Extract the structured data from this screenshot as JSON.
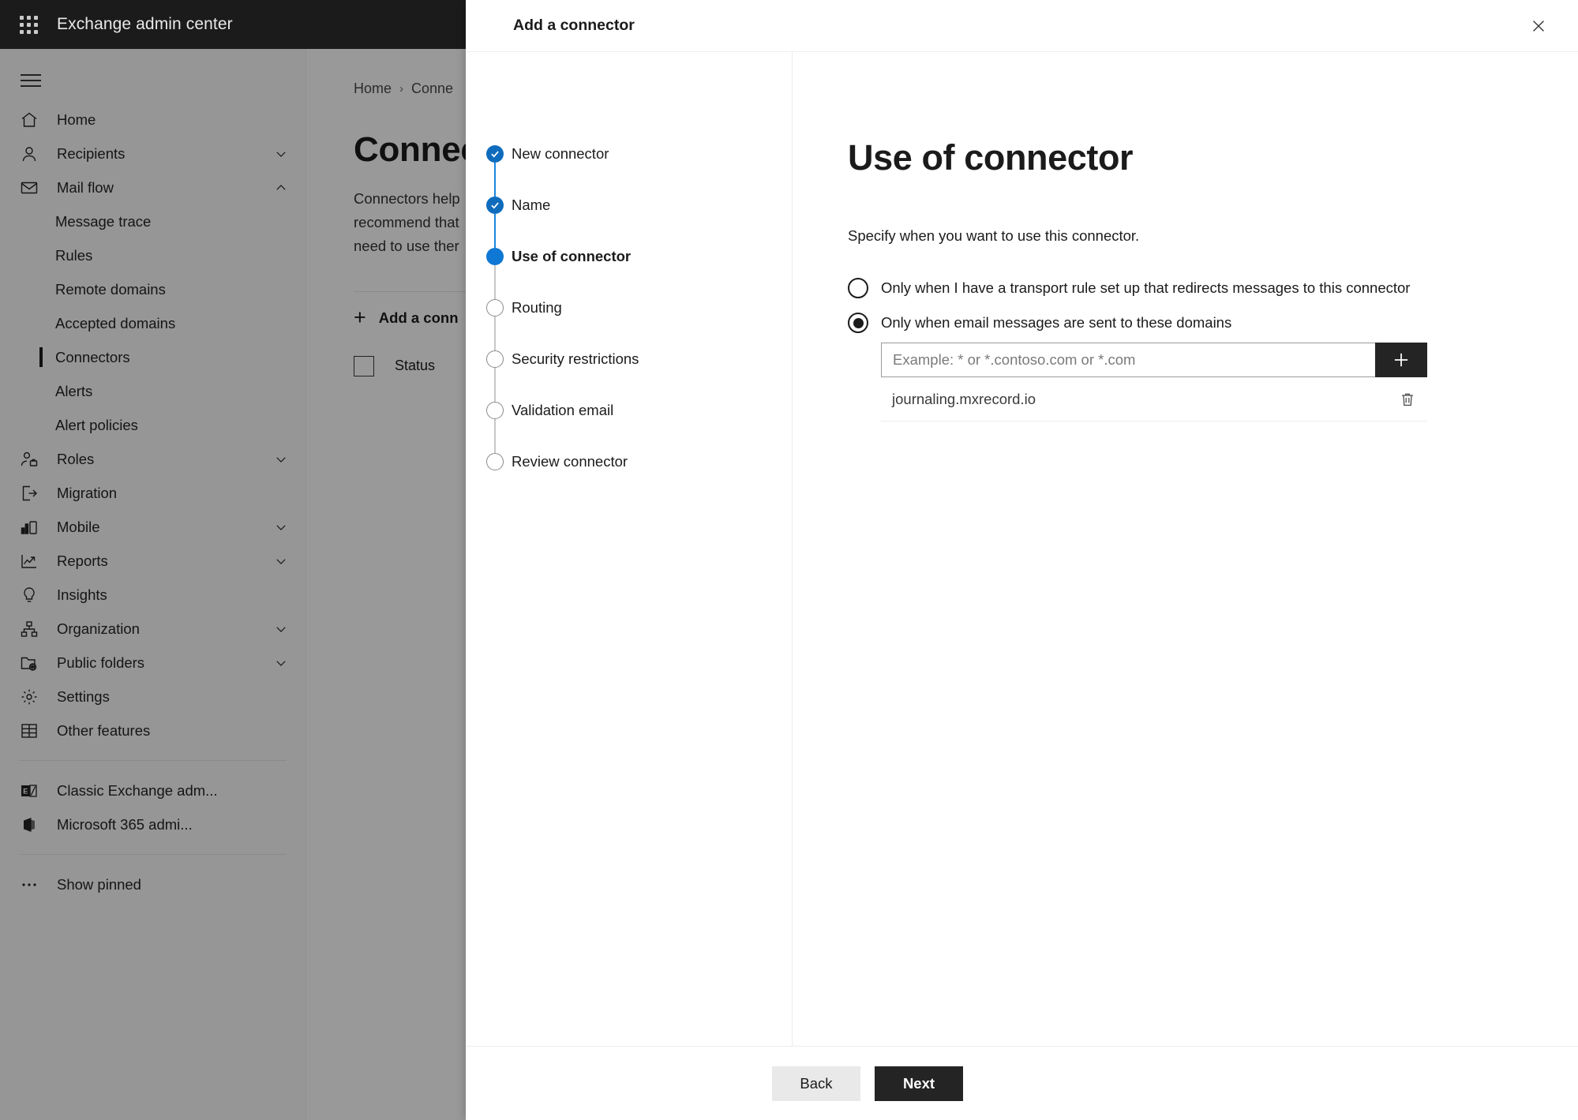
{
  "colors": {
    "topbar_bg": "#1b1b1b",
    "accent_blue": "#0f78d4",
    "primary_button_bg": "#242424",
    "secondary_button_bg": "#e9e9e9",
    "overlay": "rgba(0,0,0,0.40)"
  },
  "topbar": {
    "waffle_icon": "app-launcher-icon",
    "title": "Exchange admin center"
  },
  "sidebar": {
    "hamburger_icon": "hamburger-menu-icon",
    "items": [
      {
        "label": "Home",
        "icon": "home-icon",
        "level": "top",
        "chevron": ""
      },
      {
        "label": "Recipients",
        "icon": "person-icon",
        "level": "top",
        "chevron": "down"
      },
      {
        "label": "Mail flow",
        "icon": "mail-icon",
        "level": "top",
        "chevron": "up"
      },
      {
        "label": "Message trace",
        "icon": "",
        "level": "sub",
        "chevron": ""
      },
      {
        "label": "Rules",
        "icon": "",
        "level": "sub",
        "chevron": ""
      },
      {
        "label": "Remote domains",
        "icon": "",
        "level": "sub",
        "chevron": ""
      },
      {
        "label": "Accepted domains",
        "icon": "",
        "level": "sub",
        "chevron": ""
      },
      {
        "label": "Connectors",
        "icon": "",
        "level": "sub",
        "chevron": "",
        "selected": true
      },
      {
        "label": "Alerts",
        "icon": "",
        "level": "sub",
        "chevron": ""
      },
      {
        "label": "Alert policies",
        "icon": "",
        "level": "sub",
        "chevron": ""
      },
      {
        "label": "Roles",
        "icon": "roles-icon",
        "level": "top",
        "chevron": "down"
      },
      {
        "label": "Migration",
        "icon": "migration-icon",
        "level": "top",
        "chevron": ""
      },
      {
        "label": "Mobile",
        "icon": "mobile-icon",
        "level": "top",
        "chevron": "down"
      },
      {
        "label": "Reports",
        "icon": "reports-chart-icon",
        "level": "top",
        "chevron": "down"
      },
      {
        "label": "Insights",
        "icon": "lightbulb-icon",
        "level": "top",
        "chevron": ""
      },
      {
        "label": "Organization",
        "icon": "organization-icon",
        "level": "top",
        "chevron": "down"
      },
      {
        "label": "Public folders",
        "icon": "public-folder-icon",
        "level": "top",
        "chevron": "down"
      },
      {
        "label": "Settings",
        "icon": "gear-icon",
        "level": "top",
        "chevron": ""
      },
      {
        "label": "Other features",
        "icon": "grid-table-icon",
        "level": "top",
        "chevron": ""
      }
    ],
    "links": [
      {
        "label": "Classic Exchange adm...",
        "icon": "classic-exchange-icon"
      },
      {
        "label": "Microsoft 365 admi...",
        "icon": "microsoft-365-icon"
      }
    ],
    "show_pinned": {
      "label": "Show pinned",
      "icon": "ellipsis-icon"
    }
  },
  "page": {
    "breadcrumb": [
      "Home",
      "Conne"
    ],
    "breadcrumb_separator": "›",
    "title": "Connect",
    "description": "Connectors help\nrecommend that\nneed to use ther",
    "command_add_label": "Add a conn",
    "command_add_icon": "plus-icon",
    "table": {
      "select_all_checkbox": "select-all-checkbox",
      "columns": [
        "Status"
      ]
    }
  },
  "dialog": {
    "title": "Add a connector",
    "close_icon": "close-icon",
    "stepper": [
      {
        "label": "New connector",
        "state": "done"
      },
      {
        "label": "Name",
        "state": "done"
      },
      {
        "label": "Use of connector",
        "state": "current"
      },
      {
        "label": "Routing",
        "state": "todo"
      },
      {
        "label": "Security restrictions",
        "state": "todo"
      },
      {
        "label": "Validation email",
        "state": "todo"
      },
      {
        "label": "Review connector",
        "state": "todo"
      }
    ],
    "pane": {
      "heading": "Use of connector",
      "subtitle": "Specify when you want to use this connector.",
      "options": [
        {
          "label": "Only when I have a transport rule set up that redirects messages to this connector",
          "checked": false
        },
        {
          "label": "Only when email messages are sent to these domains",
          "checked": true
        }
      ],
      "domain_input": {
        "value": "",
        "placeholder": "Example: * or *.contoso.com or *.com",
        "add_button_icon": "plus-icon"
      },
      "domains": [
        {
          "name": "journaling.mxrecord.io",
          "delete_icon": "trash-icon"
        }
      ]
    },
    "footer": {
      "back_label": "Back",
      "next_label": "Next"
    }
  }
}
